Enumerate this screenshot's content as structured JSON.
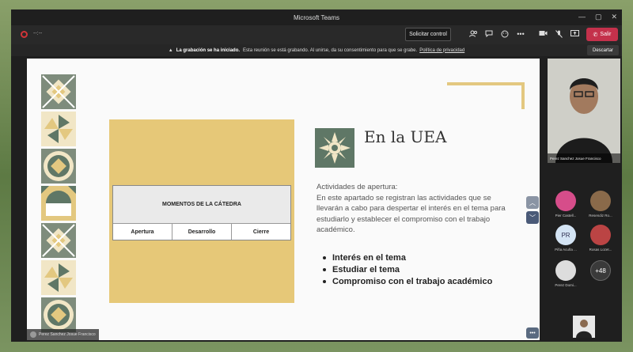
{
  "window": {
    "title": "Microsoft Teams",
    "controls": {
      "minimize": "—",
      "maximize": "▢",
      "close": "✕"
    }
  },
  "toolbar": {
    "timer": "--:--",
    "request_control_label": "Solicitar control",
    "icons": [
      "people-icon",
      "chat-icon",
      "reactions-icon",
      "more-icon",
      "camera-icon",
      "mic-off-icon",
      "share-icon"
    ],
    "leave_label": "Salir"
  },
  "recording_banner": {
    "bold": "La grabación se ha iniciado.",
    "text": "Esta reunión se está grabando. Al unirse, da su consentimiento para que se grabe.",
    "link": "Política de privacidad",
    "dismiss_label": "Descartar"
  },
  "slide": {
    "table_title": "MOMENTOS DE LA CÁTEDRA",
    "table_columns": [
      "Apertura",
      "Desarrollo",
      "Cierre"
    ],
    "heading": "En la UEA",
    "paragraph_title": "Actividades de apertura:",
    "paragraph": "En este apartado se registran las actividades que se llevarán a cabo para despertar el interés en el tema para estudiarlo y establecer el compromiso con el trabajo académico.",
    "bullets": [
      "Interés en el tema",
      "Estudiar el tema",
      "Compromiso con el trabajo académico"
    ],
    "colors": {
      "gold": "#e6c878",
      "green": "#5f7766",
      "corner": "#e3c880"
    }
  },
  "presenter_tag": "Perez Sanchez Josue Francisco",
  "participants": {
    "featured_name": "Perez Sanchez Josue Francisco",
    "list": [
      {
        "name": "Pier Castell...",
        "initials": "",
        "color": "#d64d8a"
      },
      {
        "name": "Resendiz Ro...",
        "initials": "",
        "color": "#8a6a4a"
      },
      {
        "name": "Piña Acuña ...",
        "initials": "PR",
        "color": "#d4e4f4"
      },
      {
        "name": "Rosas Lozet...",
        "initials": "",
        "color": "#b44"
      },
      {
        "name": "Perez Domi...",
        "initials": "",
        "color": "#ddd"
      }
    ],
    "overflow": "+48"
  }
}
